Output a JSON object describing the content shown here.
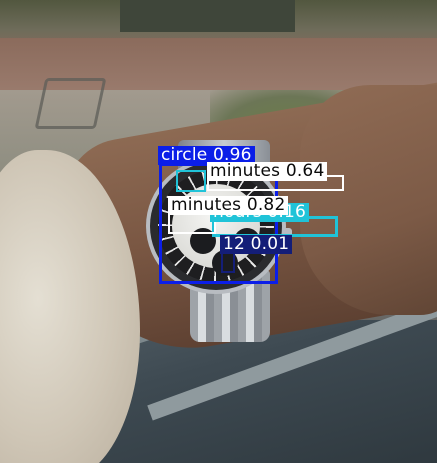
{
  "detections": [
    {
      "label": "circle 0.96",
      "color": "#0b1ee8"
    },
    {
      "label": "minutes 0.64",
      "color": "#ffffff"
    },
    {
      "label": "minutes 0.82",
      "color": "#ffffff"
    },
    {
      "label": "hours 0.16",
      "color": "#20c3d8"
    },
    {
      "label": "12 0.01",
      "color": "#141e78"
    }
  ]
}
